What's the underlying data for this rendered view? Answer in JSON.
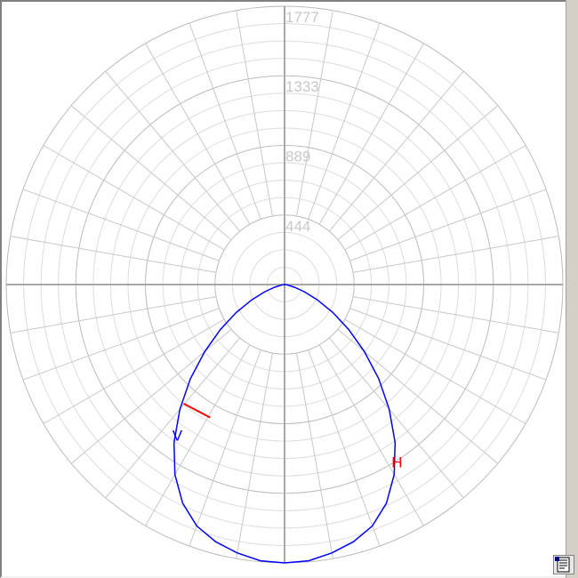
{
  "chart_data": {
    "type": "polar",
    "title": "",
    "radial_max": 1777,
    "radial_ticks": [
      444,
      889,
      1333,
      1777
    ],
    "angular_step_deg": 10,
    "grid": true,
    "series": [
      {
        "name": "H",
        "color": "#0000ff",
        "label_color": "#ff0000",
        "angles_deg": [
          0,
          5,
          10,
          15,
          20,
          25,
          30,
          35,
          40,
          45,
          50,
          55,
          60,
          65,
          70,
          75,
          80,
          85,
          90
        ],
        "values": [
          1777,
          1770,
          1740,
          1700,
          1640,
          1540,
          1400,
          1230,
          1040,
          850,
          665,
          500,
          355,
          230,
          135,
          65,
          22,
          6,
          0
        ]
      },
      {
        "name": "V",
        "color": "#0000ff",
        "label_color": "#0000ff",
        "highlight_color": "#ff0000",
        "angles_deg": [
          0,
          5,
          10,
          15,
          20,
          25,
          30,
          35,
          40,
          45,
          50,
          55,
          60,
          65,
          70,
          75,
          80,
          85,
          90
        ],
        "values": [
          1777,
          1770,
          1740,
          1700,
          1640,
          1540,
          1400,
          1230,
          1040,
          850,
          665,
          500,
          355,
          230,
          135,
          65,
          22,
          6,
          0
        ]
      }
    ]
  },
  "toolbar": {
    "doc_button_icon": "document-properties-icon"
  }
}
